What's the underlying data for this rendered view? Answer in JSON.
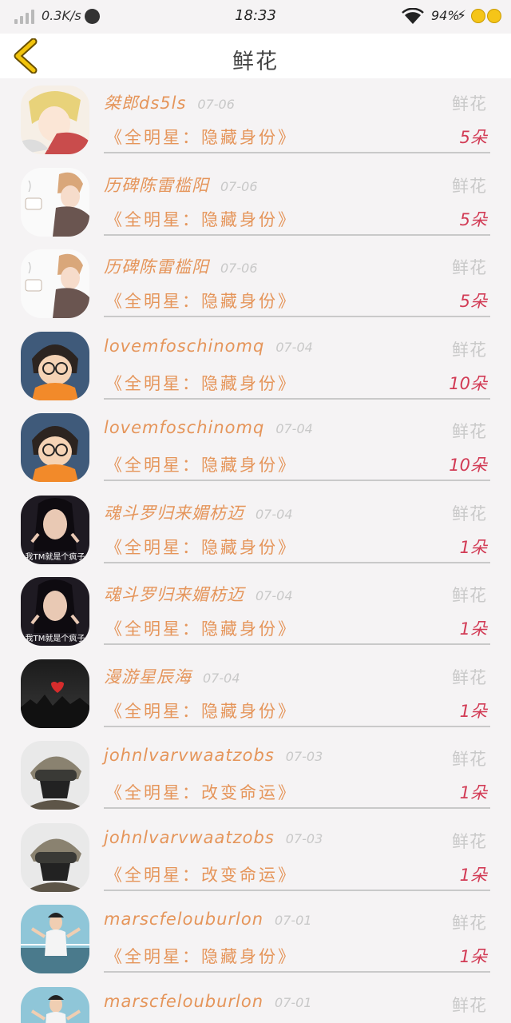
{
  "status_bar": {
    "net_speed": "0.3K/s",
    "time": "18:33",
    "battery": "94%"
  },
  "header": {
    "title": "鲜花",
    "back_icon": "chevron-left-icon"
  },
  "colors": {
    "name": "#e5955a",
    "count": "#d23b55",
    "muted": "#c9c9c9",
    "back_arrow": "#e0b400"
  },
  "records": [
    {
      "user": "桀郎ds5ls",
      "date": "07-06",
      "gift": "鲜花",
      "book": "《全明星：隐藏身份》",
      "count": "5朵",
      "avatar": "anime-boy"
    },
    {
      "user": "历碑陈雷槛阳",
      "date": "07-06",
      "gift": "鲜花",
      "book": "《全明星：隐藏身份》",
      "count": "5朵",
      "avatar": "anime-tea"
    },
    {
      "user": "历碑陈雷槛阳",
      "date": "07-06",
      "gift": "鲜花",
      "book": "《全明星：隐藏身份》",
      "count": "5朵",
      "avatar": "anime-tea"
    },
    {
      "user": "lovemfoschinomq",
      "date": "07-04",
      "gift": "鲜花",
      "book": "《全明星：隐藏身份》",
      "count": "10朵",
      "avatar": "conan"
    },
    {
      "user": "lovemfoschinomq",
      "date": "07-04",
      "gift": "鲜花",
      "book": "《全明星：隐藏身份》",
      "count": "10朵",
      "avatar": "conan"
    },
    {
      "user": "魂斗罗归来媚枋迈",
      "date": "07-04",
      "gift": "鲜花",
      "book": "《全明星：隐藏身份》",
      "count": "1朵",
      "avatar": "girl-photo",
      "avatar_caption": "我TM就是个疯子"
    },
    {
      "user": "魂斗罗归来媚枋迈",
      "date": "07-04",
      "gift": "鲜花",
      "book": "《全明星：隐藏身份》",
      "count": "1朵",
      "avatar": "girl-photo",
      "avatar_caption": "我TM就是个疯子"
    },
    {
      "user": "漫游星辰海",
      "date": "07-04",
      "gift": "鲜花",
      "book": "《全明星：隐藏身份》",
      "count": "1朵",
      "avatar": "night-heart"
    },
    {
      "user": "johnlvarvwaatzobs",
      "date": "07-03",
      "gift": "鲜花",
      "book": "《全明星：改变命运》",
      "count": "1朵",
      "avatar": "soldier"
    },
    {
      "user": "johnlvarvwaatzobs",
      "date": "07-03",
      "gift": "鲜花",
      "book": "《全明星：改变命运》",
      "count": "1朵",
      "avatar": "soldier"
    },
    {
      "user": "marscfelouburlon",
      "date": "07-01",
      "gift": "鲜花",
      "book": "《全明星：隐藏身份》",
      "count": "1朵",
      "avatar": "man-court"
    },
    {
      "user": "marscfelouburlon",
      "date": "07-01",
      "gift": "鲜花",
      "book": "",
      "count": "",
      "avatar": "man-court"
    }
  ]
}
